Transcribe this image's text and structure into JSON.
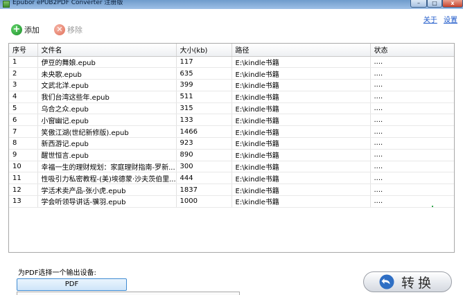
{
  "window": {
    "title": "Epubor ePUB2PDF Converter 注册版"
  },
  "header_links": {
    "about": "关于",
    "settings": "设置"
  },
  "toolbar": {
    "add_label": "添加",
    "remove_label": "移除"
  },
  "table": {
    "columns": [
      "序号",
      "文件名",
      "大小(kb)",
      "路径",
      "状态"
    ],
    "rows": [
      {
        "num": "1",
        "name": "伊豆的舞娘.epub",
        "size": "117",
        "path": "E:\\kindle书籍",
        "status": "...."
      },
      {
        "num": "2",
        "name": "未央歌.epub",
        "size": "635",
        "path": "E:\\kindle书籍",
        "status": "...."
      },
      {
        "num": "3",
        "name": "文武北洋.epub",
        "size": "399",
        "path": "E:\\kindle书籍",
        "status": "...."
      },
      {
        "num": "4",
        "name": "我们台湾这些年.epub",
        "size": "511",
        "path": "E:\\kindle书籍",
        "status": "...."
      },
      {
        "num": "5",
        "name": "乌合之众.epub",
        "size": "315",
        "path": "E:\\kindle书籍",
        "status": "...."
      },
      {
        "num": "6",
        "name": "小窗幽记.epub",
        "size": "133",
        "path": "E:\\kindle书籍",
        "status": "...."
      },
      {
        "num": "7",
        "name": "笑傲江湖(世纪新修版).epub",
        "size": "1466",
        "path": "E:\\kindle书籍",
        "status": "...."
      },
      {
        "num": "8",
        "name": "新西游记.epub",
        "size": "923",
        "path": "E:\\kindle书籍",
        "status": "...."
      },
      {
        "num": "9",
        "name": "醒世恒言.epub",
        "size": "890",
        "path": "E:\\kindle书籍",
        "status": "...."
      },
      {
        "num": "10",
        "name": "幸福一生的理财规划：家庭理财指南-罗新...",
        "size": "300",
        "path": "E:\\kindle书籍",
        "status": "...."
      },
      {
        "num": "11",
        "name": "性吸引力私密教程-(美)埃德蒙·沙夫茨伯里...",
        "size": "444",
        "path": "E:\\kindle书籍",
        "status": "...."
      },
      {
        "num": "12",
        "name": "学活术卖产品-张小虎.epub",
        "size": "1837",
        "path": "E:\\kindle书籍",
        "status": "...."
      },
      {
        "num": "13",
        "name": "学会听领导讲话-骥羽.epub",
        "size": "1000",
        "path": "E:\\kindle书籍",
        "status": "...."
      }
    ]
  },
  "output": {
    "label": "为PDF选择一个输出设备:",
    "device_button": "PDF"
  },
  "convert": {
    "label": "转换"
  },
  "colors": {
    "accent": "#3e8ad1",
    "add_green": "#1c8f2a",
    "link_blue": "#1a56c9"
  }
}
